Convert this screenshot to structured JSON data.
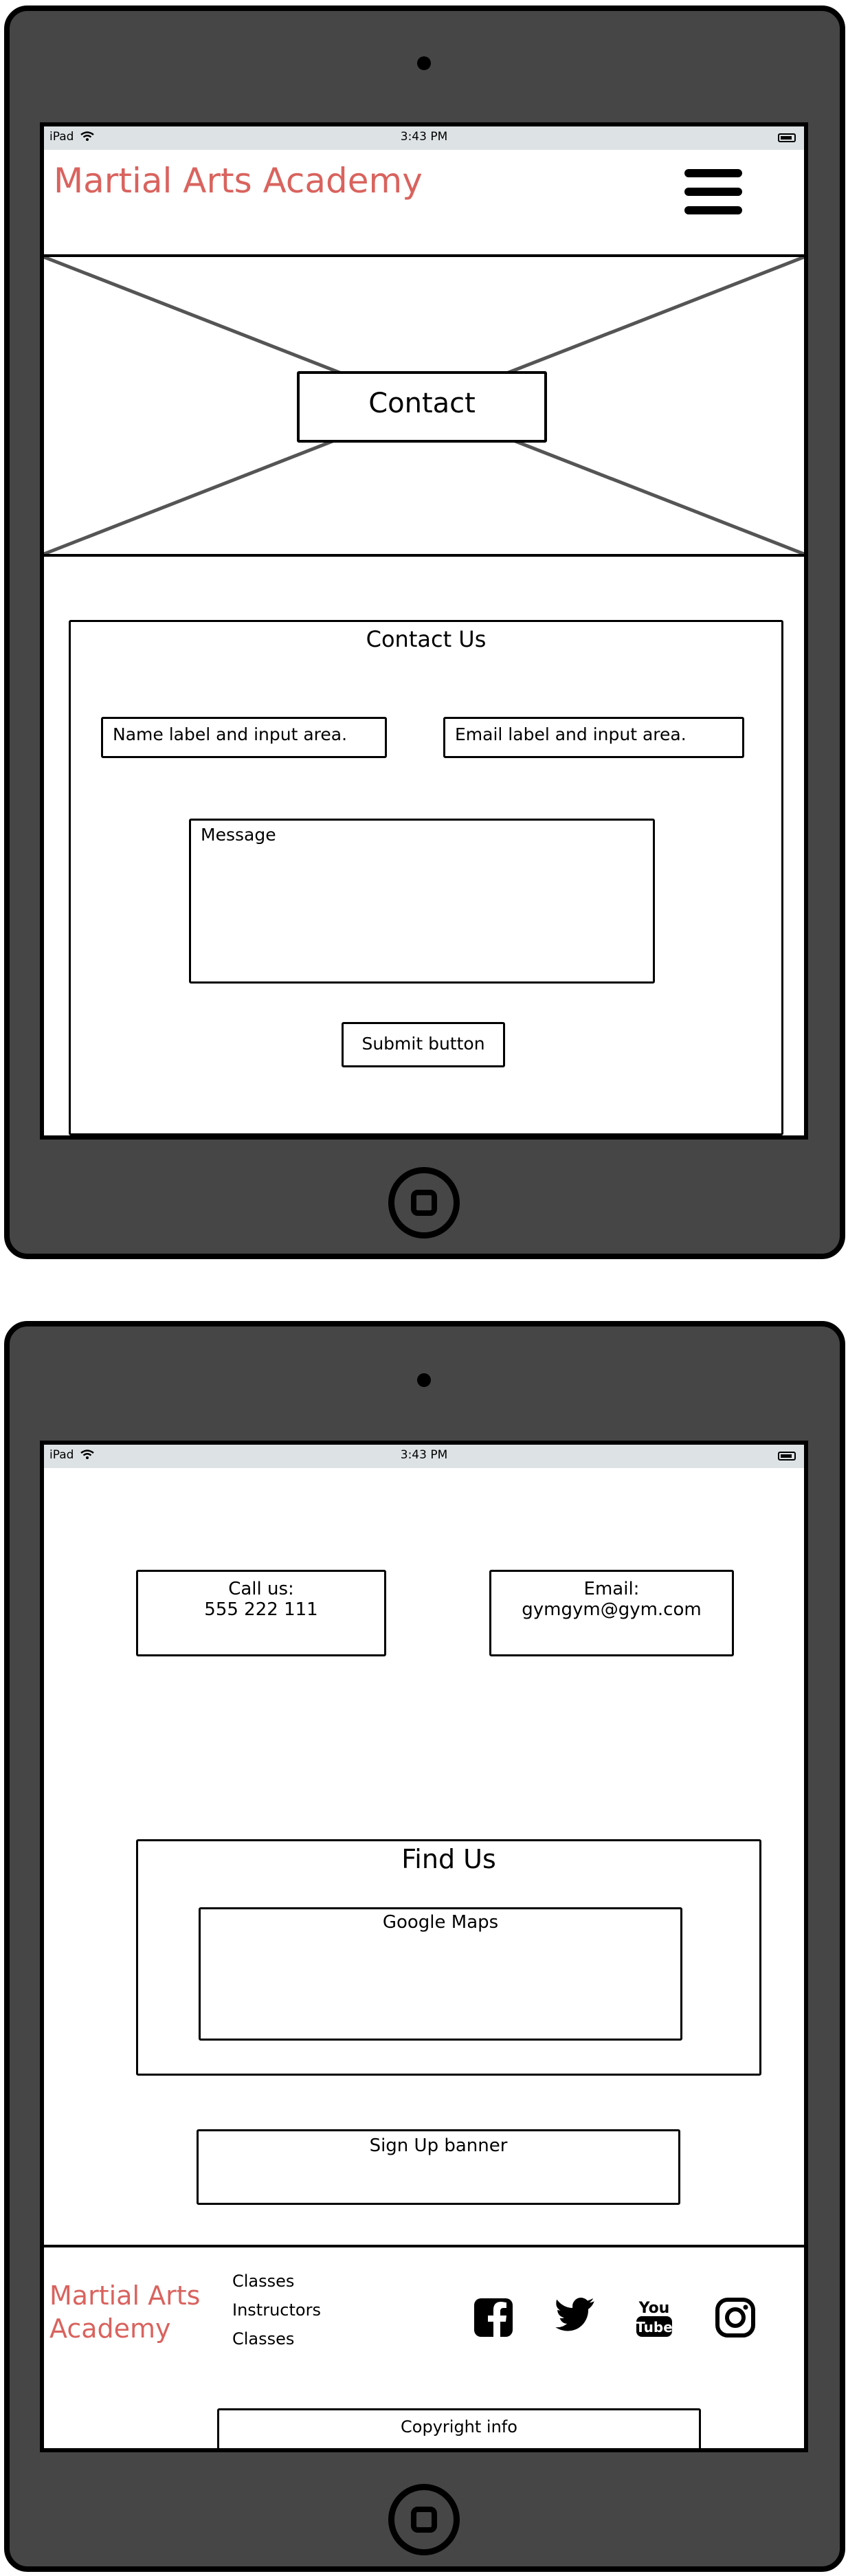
{
  "status_bar": {
    "device": "iPad",
    "time": "3:43 PM"
  },
  "header": {
    "brand": "Martial Arts Academy"
  },
  "hero": {
    "title": "Contact"
  },
  "contact_form": {
    "heading": "Contact Us",
    "name_field": "Name label and input area.",
    "email_field": "Email label and input area.",
    "message_field": "Message",
    "submit": "Submit button"
  },
  "contact_info": {
    "call_label": "Call us:",
    "call_number": "555 222 111",
    "email_label": "Email:",
    "email_address": "gymgym@gym.com"
  },
  "find_us": {
    "heading": "Find Us",
    "map": "Google Maps"
  },
  "signup": {
    "label": "Sign Up banner"
  },
  "footer": {
    "brand_line1": "Martial Arts",
    "brand_line2": "Academy",
    "links": [
      "Classes",
      "Instructors",
      "Classes"
    ],
    "social_icons": [
      "facebook-icon",
      "twitter-icon",
      "youtube-icon",
      "instagram-icon"
    ],
    "copyright": "Copyright info"
  },
  "colors": {
    "brand": "#d9635e",
    "device": "#464646",
    "statusbar": "#dde3e5"
  }
}
